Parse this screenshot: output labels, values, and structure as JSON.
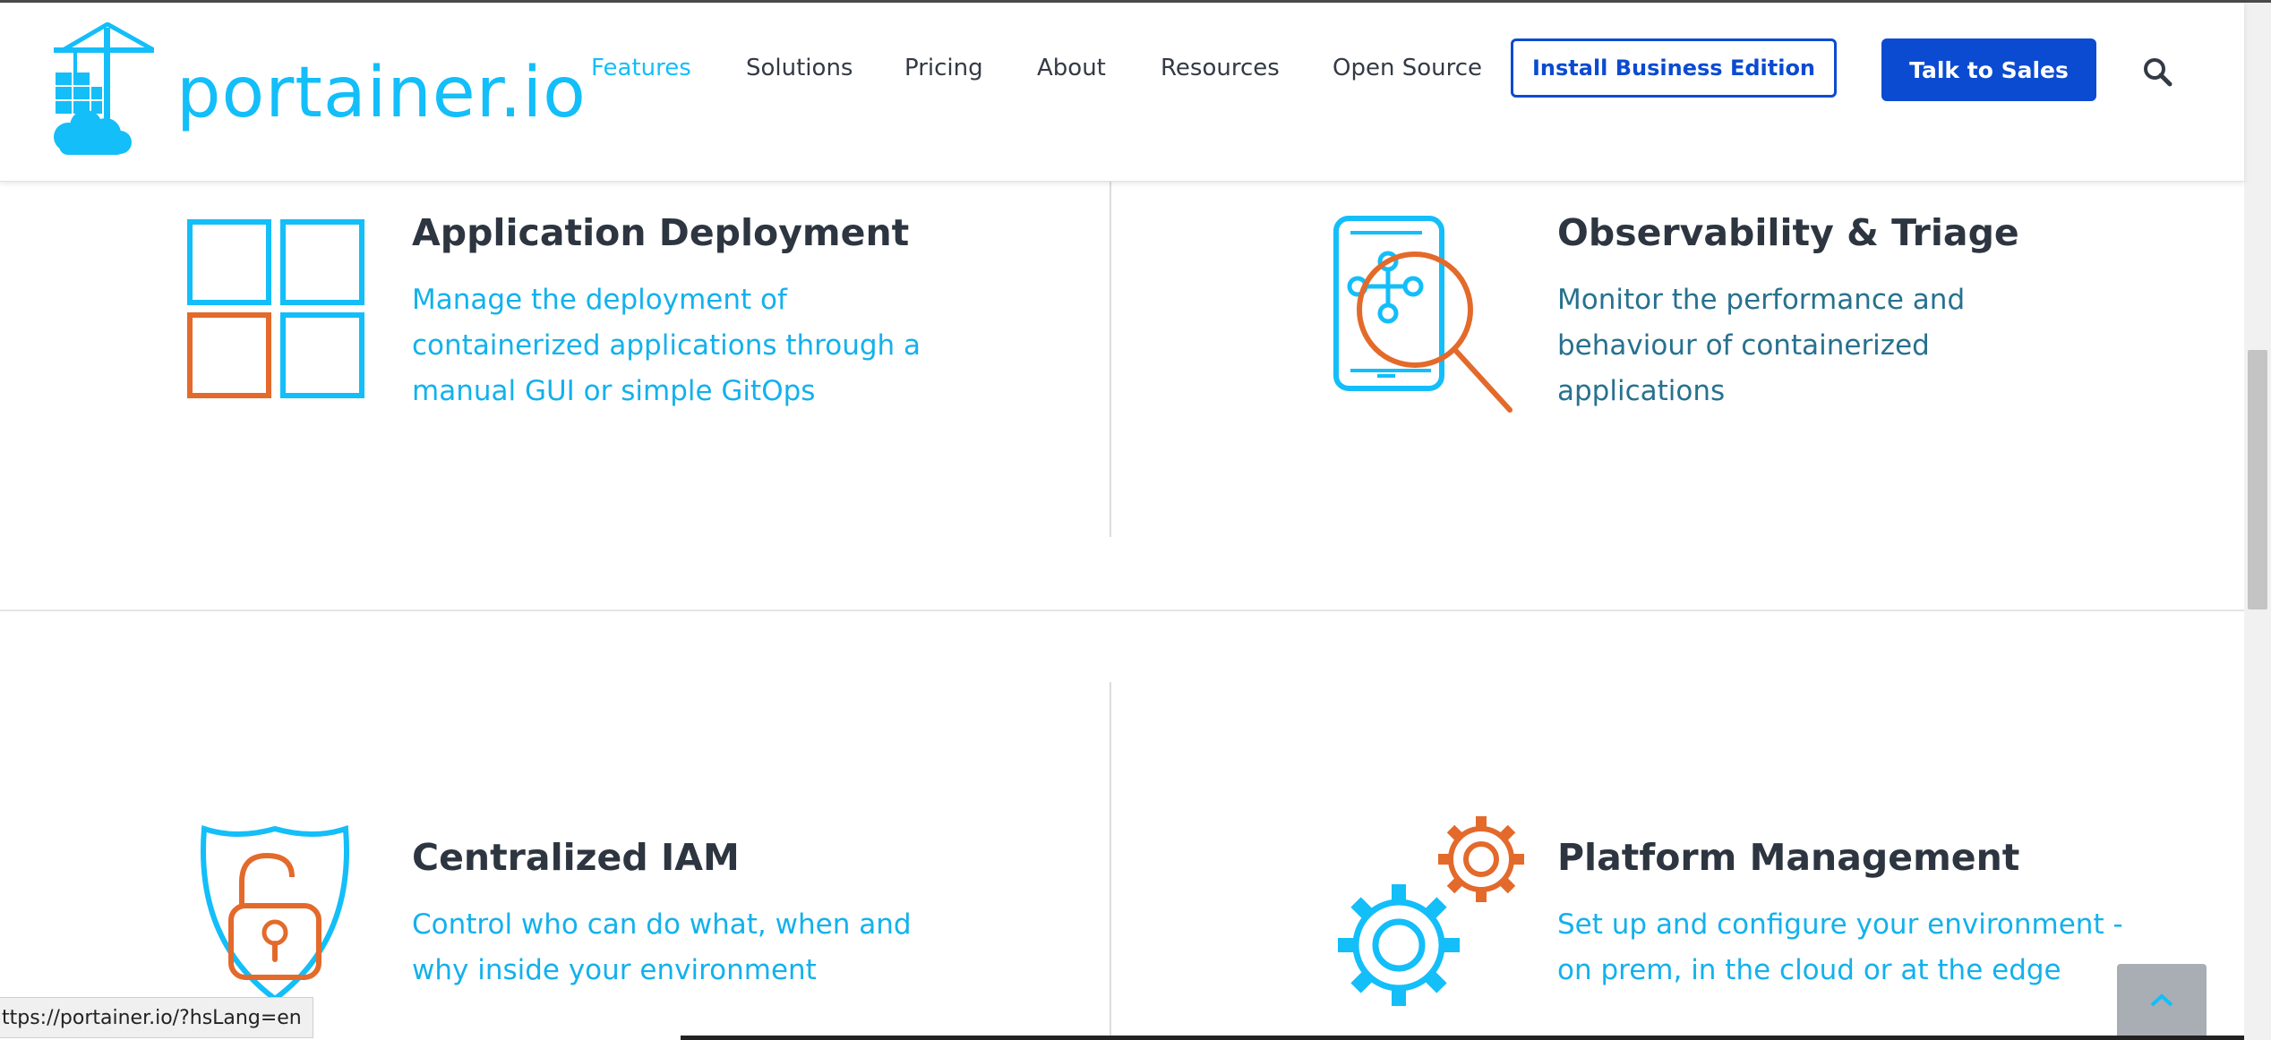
{
  "brand": {
    "logo_text": "portainer.io",
    "primary_color": "#13bef9",
    "accent_color": "#e36a2b",
    "button_color": "#0b4bd1"
  },
  "nav": {
    "items": [
      {
        "label": "Features",
        "active": true
      },
      {
        "label": "Solutions",
        "active": false
      },
      {
        "label": "Pricing",
        "active": false
      },
      {
        "label": "About",
        "active": false
      },
      {
        "label": "Resources",
        "active": false
      },
      {
        "label": "Open Source",
        "active": false
      }
    ],
    "install_button": "Install Business Edition",
    "sales_button": "Talk to Sales",
    "search_icon": "search-icon"
  },
  "features": [
    {
      "title": "Application Deployment",
      "description": "Manage the deployment of containerized applications through a manual GUI or simple GitOps",
      "icon": "grid-icon"
    },
    {
      "title": "Observability & Triage",
      "description": "Monitor the performance and behaviour of containerized applications",
      "icon": "phone-magnifier-icon"
    },
    {
      "title": "Centralized IAM",
      "description": "Control who can do what, when and why inside your environment",
      "icon": "shield-lock-icon"
    },
    {
      "title": "Platform Management",
      "description": "Set up and configure your environment - on prem, in the cloud or at the edge",
      "icon": "gears-icon"
    }
  ],
  "status_bar": {
    "url": "ttps://portainer.io/?hsLang=en"
  },
  "back_to_top_icon": "chevron-up-icon"
}
